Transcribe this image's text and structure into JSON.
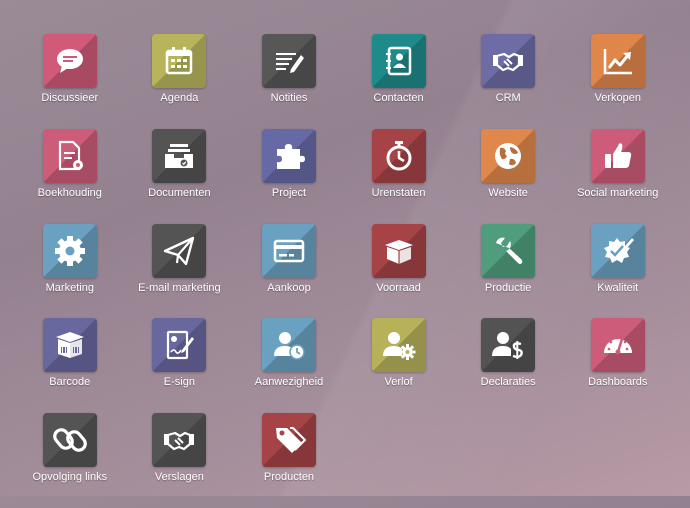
{
  "apps": [
    {
      "label": "Discussieer",
      "icon": "chat-bubble-icon",
      "color": "#d05a78"
    },
    {
      "label": "Agenda",
      "icon": "calendar-icon",
      "color": "#b8b45c"
    },
    {
      "label": "Notities",
      "icon": "notes-icon",
      "color": "#585757"
    },
    {
      "label": "Contacten",
      "icon": "address-book-icon",
      "color": "#1f8a8a"
    },
    {
      "label": "CRM",
      "icon": "handshake-icon",
      "color": "#6d6ca5"
    },
    {
      "label": "Verkopen",
      "icon": "trend-chart-icon",
      "color": "#e0864a"
    },
    {
      "label": "Boekhouding",
      "icon": "invoice-gear-icon",
      "color": "#cc5c77"
    },
    {
      "label": "Documenten",
      "icon": "inbox-tray-icon",
      "color": "#555454"
    },
    {
      "label": "Project",
      "icon": "puzzle-icon",
      "color": "#6769a5"
    },
    {
      "label": "Urenstaten",
      "icon": "stopwatch-icon",
      "color": "#a54346"
    },
    {
      "label": "Website",
      "icon": "globe-icon",
      "color": "#e0874b"
    },
    {
      "label": "Social marketing",
      "icon": "thumbs-up-icon",
      "color": "#cc5c77"
    },
    {
      "label": "Marketing",
      "icon": "gear-icon",
      "color": "#6aa0c0"
    },
    {
      "label": "E-mail marketing",
      "icon": "paper-plane-icon",
      "color": "#545454"
    },
    {
      "label": "Aankoop",
      "icon": "credit-card-icon",
      "color": "#6aa0c0"
    },
    {
      "label": "Voorraad",
      "icon": "open-box-icon",
      "color": "#a54346"
    },
    {
      "label": "Productie",
      "icon": "wrench-icon",
      "color": "#4f9d7d"
    },
    {
      "label": "Kwaliteit",
      "icon": "quality-badge-icon",
      "color": "#6aa0c0"
    },
    {
      "label": "Barcode",
      "icon": "barcode-box-icon",
      "color": "#68679e"
    },
    {
      "label": "E-sign",
      "icon": "sign-document-icon",
      "color": "#68679e"
    },
    {
      "label": "Aanwezigheid",
      "icon": "user-clock-icon",
      "color": "#6aa0c0"
    },
    {
      "label": "Verlof",
      "icon": "user-gear-icon",
      "color": "#b7b15a"
    },
    {
      "label": "Declaraties",
      "icon": "user-dollar-icon",
      "color": "#535353"
    },
    {
      "label": "Dashboards",
      "icon": "speedometer-icon",
      "color": "#cc5c77"
    },
    {
      "label": "Opvolging links",
      "icon": "chain-link-icon",
      "color": "#545454"
    },
    {
      "label": "Verslagen",
      "icon": "handshake-icon",
      "color": "#545454"
    },
    {
      "label": "Producten",
      "icon": "price-tags-icon",
      "color": "#a54346"
    }
  ]
}
